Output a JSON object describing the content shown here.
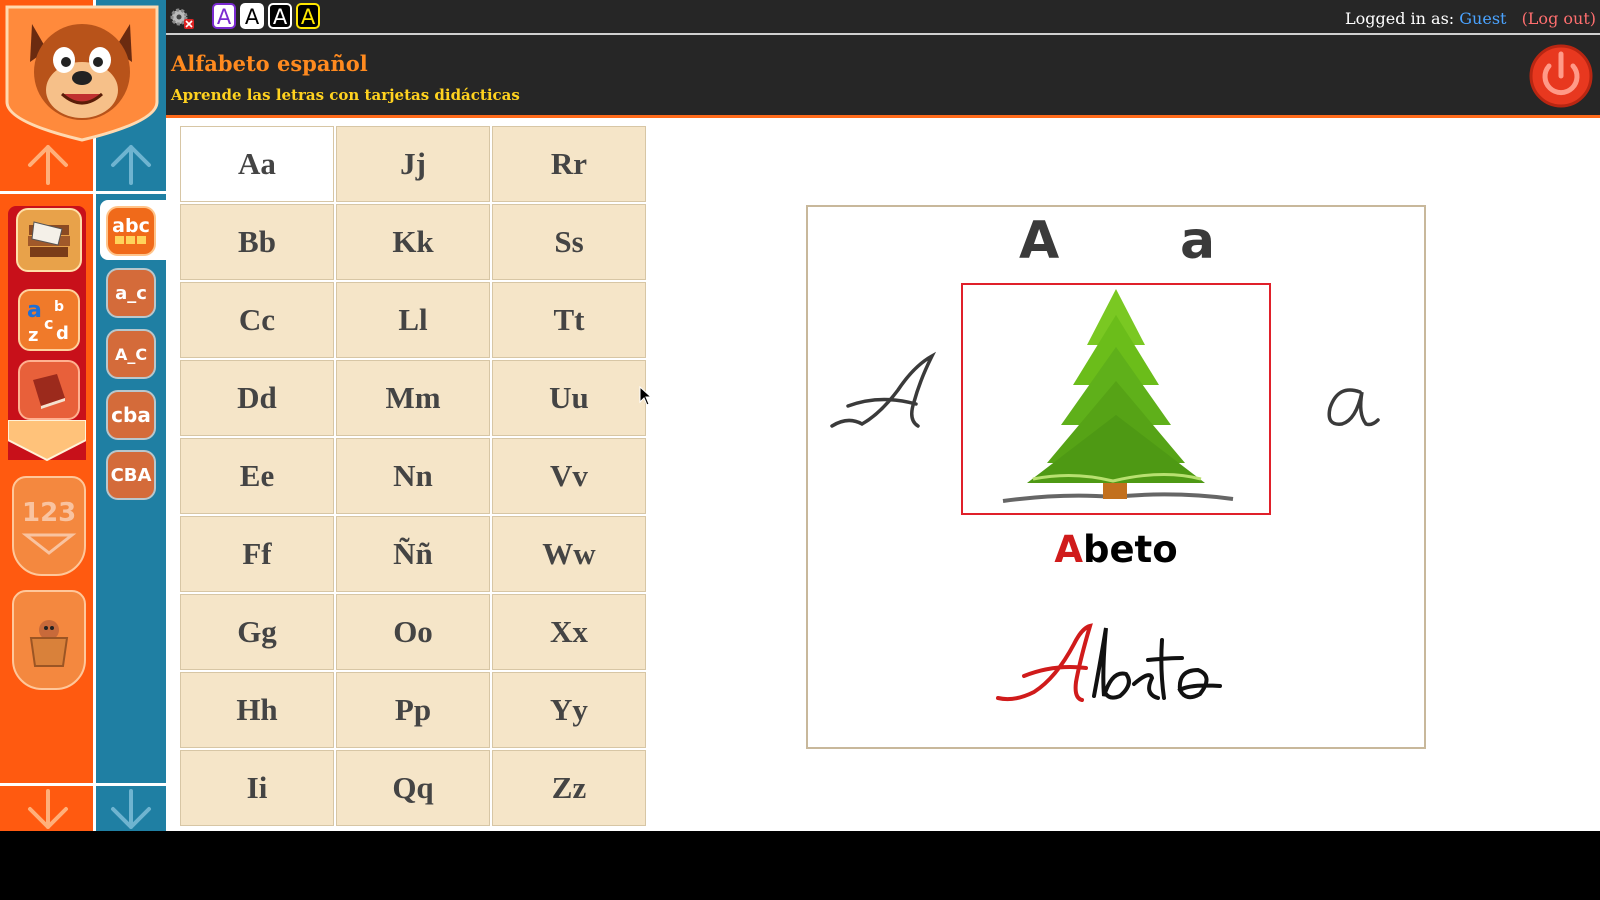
{
  "header": {
    "logged_in_label": "Logged in as:",
    "user": "Guest",
    "logout": "(Log out)",
    "title": "Alfabeto español",
    "subtitle": "Aprende las letras con tarjetas didácticas",
    "font_buttons": [
      "A",
      "A",
      "A",
      "A"
    ]
  },
  "sidebar": {
    "apps": [
      "books",
      "abc-letters",
      "red-book",
      "123-numbers",
      "dog-in-box"
    ],
    "sub_items": [
      "abc",
      "a_c",
      "A_C",
      "cba",
      "CBA"
    ]
  },
  "letters": [
    "Aa",
    "Jj",
    "Rr",
    "Bb",
    "Kk",
    "Ss",
    "Cc",
    "Ll",
    "Tt",
    "Dd",
    "Mm",
    "Uu",
    "Ee",
    "Nn",
    "Vv",
    "Ff",
    "Ññ",
    "Ww",
    "Gg",
    "Oo",
    "Xx",
    "Hh",
    "Pp",
    "Yy",
    "Ii",
    "Qq",
    "Zz"
  ],
  "selected_letter": "Aa",
  "card": {
    "upper": "A",
    "lower": "a",
    "word_first": "A",
    "word_rest": "beto",
    "image": "fir-tree"
  },
  "colors": {
    "orange": "#ff5a10",
    "teal": "#1f7fa3",
    "header_bg": "#262626",
    "cell_bg": "#f5e5c8",
    "accent_red": "#d01b1b"
  }
}
